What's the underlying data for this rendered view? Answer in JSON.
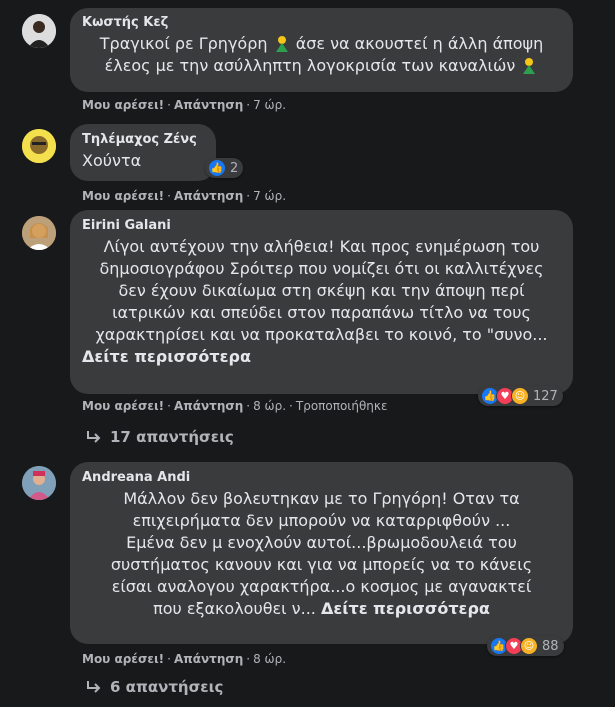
{
  "comments": [
    {
      "author": "Κωστής Κεζ",
      "lines": [
        "Τραγικοί ρε Γρηγόρη",
        "άσε να ακουστεί η άλλη άποψη",
        "έλεος με την ασύλληπτη λογοκρισία των καναλιών"
      ],
      "emoji_icon": "person-gesturing-no-icon",
      "actions": {
        "like": "Μου αρέσει!",
        "reply": "Απάντηση",
        "time": "7 ώρ."
      }
    },
    {
      "author": "Τηλέμαχος Ζένς",
      "text": "Χούντα",
      "reactions": {
        "icons": [
          "like-icon"
        ],
        "count": "2"
      },
      "actions": {
        "like": "Μου αρέσει!",
        "reply": "Απάντηση",
        "time": "7 ώρ."
      }
    },
    {
      "author": "Eirini Galani",
      "lines": [
        "Λίγοι αντέχουν την αλήθεια! Και προς ενημέρωση του",
        "δημοσιογράφου Σρόιτερ που νομίζει ότι οι καλλιτέχνες",
        "δεν έχουν δικαίωμα στη σκέψη και την άποψη περί",
        "ιατρικών και σπεύδει στον παραπάνω τίτλο να τους",
        "χαρακτηρίσει και να προκαταλαβει το κοινό, το \"συνο..."
      ],
      "more": "Δείτε περισσότερα",
      "reactions": {
        "icons": [
          "like-icon",
          "love-icon",
          "haha-icon"
        ],
        "count": "127"
      },
      "actions": {
        "like": "Μου αρέσει!",
        "reply": "Απάντηση",
        "time": "8 ώρ.",
        "edited": "Τροποποιήθηκε"
      },
      "replies": "17 απαντήσεις"
    },
    {
      "author": "Andreana Andi",
      "lines": [
        "Μάλλον δεν βολευτηκαν με το Γρηγόρη! Οταν τα",
        "επιχειρήματα δεν μπορούν να καταρριφθούν ...",
        "Εμένα δεν μ ενοχλούν αυτοί...βρωμοδουλειά του",
        "συστήματος κανουν και για να μπορείς να το κάνεις",
        "είσαι αναλογου χαρακτήρα...ο κοσμος με αγανακτεί",
        "που εξακολουθει ν..."
      ],
      "more": "Δείτε περισσότερα",
      "reactions": {
        "icons": [
          "like-icon",
          "love-icon",
          "care-icon"
        ],
        "count": "88"
      },
      "actions": {
        "like": "Μου αρέσει!",
        "reply": "Απάντηση",
        "time": "8 ώρ."
      },
      "replies": "6 απαντήσεις"
    }
  ],
  "colors": {
    "background": "#18191a",
    "bubble": "#3a3b3c",
    "text": "#e4e6eb",
    "muted": "#b0b3b8",
    "like": "#1877f2",
    "love": "#f33e58",
    "haha": "#f7b125"
  }
}
